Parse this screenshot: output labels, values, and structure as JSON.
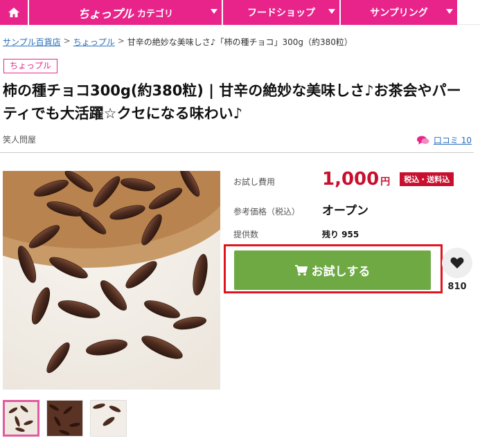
{
  "nav": {
    "home_icon": "home-icon",
    "logo_text": "ちょっプル",
    "category_label": "カテゴリ",
    "food_label": "フードショップ",
    "sample_label": "サンプリング"
  },
  "breadcrumb": {
    "items": [
      "サンプル百貨店",
      "ちょっプル",
      "甘辛の絶妙な美味しさ♪「柿の種チョコ」300g（約380粒）"
    ],
    "separator": ">"
  },
  "product": {
    "tag": "ちょっプル",
    "title": "柿の種チョコ300g(約380粒) | 甘辛の絶妙な美味しさ♪お茶会やパーティでも大活躍☆クセになる味わい♪",
    "seller": "笑人問屋",
    "review_label": "口コミ 10",
    "price_label": "お試し費用",
    "price_value": "1,000",
    "price_unit": "円",
    "tax_badge": "税込・送料込",
    "ref_label": "参考価格（税込）",
    "ref_value": "オープン",
    "stock_label": "提供数",
    "stock_value": "残り 955",
    "cta_label": "お試しする",
    "favorite_count": "810"
  },
  "colors": {
    "brand_pink": "#e8248a",
    "price_red": "#c8102e",
    "cta_green": "#6ea944",
    "highlight_red": "#e0141e"
  }
}
